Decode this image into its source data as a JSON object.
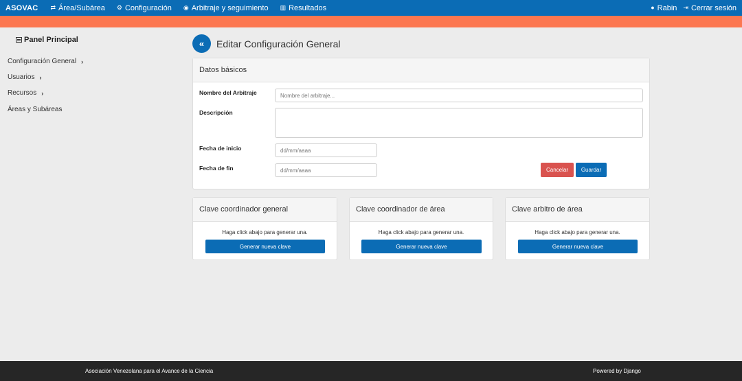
{
  "nav": {
    "brand": "ASOVAC",
    "items": [
      {
        "label": "Área/Subárea",
        "icon": "exchange-icon"
      },
      {
        "label": "Configuración",
        "icon": "cogs-icon"
      },
      {
        "label": "Arbitraje y seguimiento",
        "icon": "eye-icon"
      },
      {
        "label": "Resultados",
        "icon": "bar-chart-icon"
      }
    ],
    "user": "Rabin",
    "logout": "Cerrar sesión"
  },
  "sidebar": {
    "title": "Panel Principal",
    "items": [
      {
        "label": "Configuración General"
      },
      {
        "label": "Usuarios"
      },
      {
        "label": "Recursos"
      },
      {
        "label": "Áreas y Subáreas"
      }
    ]
  },
  "main": {
    "title": "Editar Configuración General",
    "basic_card": {
      "header": "Datos básicos",
      "name_label": "Nombre del Arbitraje",
      "name_placeholder": "Nombre del arbitraje...",
      "desc_label": "Descripción",
      "start_label": "Fecha de inicio",
      "start_value": "dd/mm/aaaa",
      "end_label": "Fecha de fin",
      "end_value": "dd/mm/aaaa",
      "cancel": "Cancelar",
      "save": "Guardar"
    },
    "key_cards": [
      {
        "header": "Clave coordinador general",
        "text": "Haga click abajo para generar una.",
        "button": "Generar nueva clave"
      },
      {
        "header": "Clave coordinador de área",
        "text": "Haga click abajo para generar una.",
        "button": "Generar nueva clave"
      },
      {
        "header": "Clave arbitro de área",
        "text": "Haga click abajo para generar una.",
        "button": "Generar nueva clave"
      }
    ]
  },
  "footer": {
    "left": "Asociación Venezolana para el Avance de la Ciencia",
    "right": "Powered by Django"
  },
  "colors": {
    "primary": "#0b6cb5",
    "accent_bar": "#fc7750",
    "danger": "#d9534f",
    "footer_bg": "#262626",
    "page_bg": "#ececec"
  }
}
